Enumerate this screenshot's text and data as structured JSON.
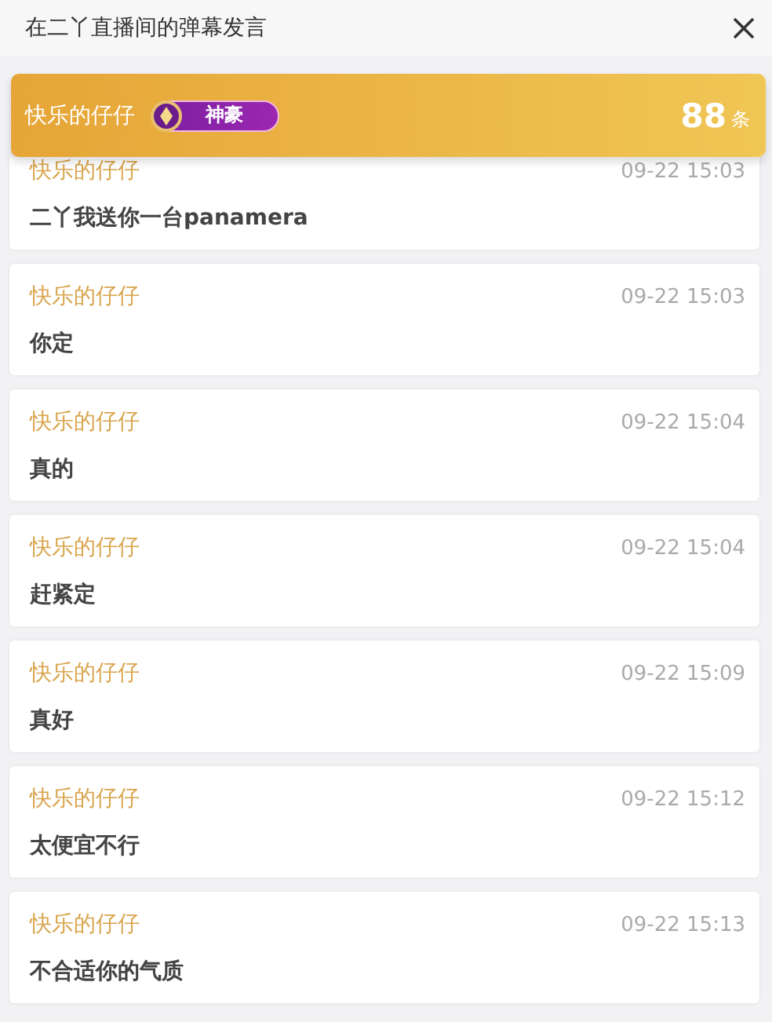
{
  "window": {
    "title": "在二丫直播间的弹幕发言"
  },
  "banner": {
    "user": "快乐的仔仔",
    "badge": "神豪",
    "count": "88",
    "count_unit": "条"
  },
  "messages": [
    {
      "user": "快乐的仔仔",
      "time": "09-22 15:03",
      "text": "二丫我送你一台panamera"
    },
    {
      "user": "快乐的仔仔",
      "time": "09-22 15:03",
      "text": "你定"
    },
    {
      "user": "快乐的仔仔",
      "time": "09-22 15:04",
      "text": "真的"
    },
    {
      "user": "快乐的仔仔",
      "time": "09-22 15:04",
      "text": "赶紧定"
    },
    {
      "user": "快乐的仔仔",
      "time": "09-22 15:09",
      "text": "真好"
    },
    {
      "user": "快乐的仔仔",
      "time": "09-22 15:12",
      "text": "太便宜不行"
    },
    {
      "user": "快乐的仔仔",
      "time": "09-22 15:13",
      "text": "不合适你的气质"
    }
  ]
}
